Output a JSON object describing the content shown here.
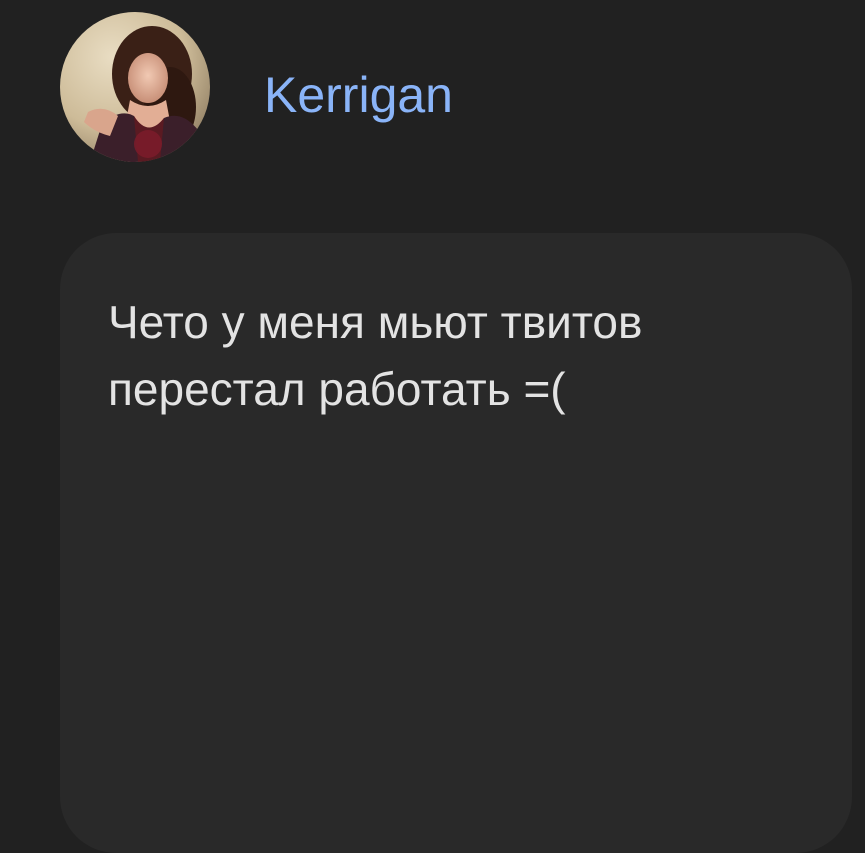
{
  "author": {
    "name": "Kerrigan",
    "avatar_icon": "profile-photo",
    "name_color": "#8ab4f8"
  },
  "message": {
    "lines": [
      "Чето у меня мьют твитов",
      "перестал работать =("
    ]
  },
  "colors": {
    "background": "#212121",
    "card": "#292929",
    "text": "#e3e3e3"
  }
}
